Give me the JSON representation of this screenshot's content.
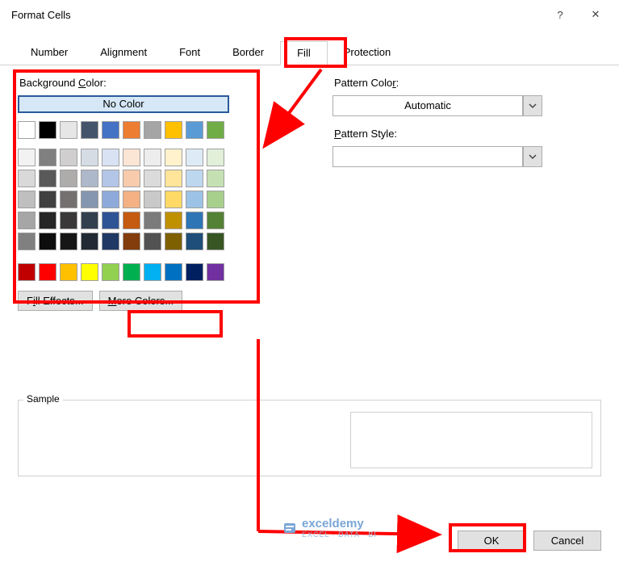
{
  "dialog": {
    "title": "Format Cells",
    "help": "?",
    "close": "✕"
  },
  "tabs": {
    "items": [
      "Number",
      "Alignment",
      "Font",
      "Border",
      "Fill",
      "Protection"
    ],
    "active": "Fill"
  },
  "fill": {
    "bg_label_pre": "Background ",
    "bg_label_u": "C",
    "bg_label_post": "olor:",
    "no_color": "No Color",
    "theme_row1": [
      "#ffffff",
      "#000000",
      "#e7e6e6",
      "#44546a",
      "#4472c4",
      "#ed7d31",
      "#a5a5a5",
      "#ffc000",
      "#5b9bd5",
      "#70ad47"
    ],
    "theme_shades": [
      [
        "#f2f2f2",
        "#808080",
        "#d0cece",
        "#d6dce4",
        "#d9e2f3",
        "#fbe5d5",
        "#ededed",
        "#fff2cc",
        "#deebf6",
        "#e2efd9"
      ],
      [
        "#d9d9d9",
        "#595959",
        "#aeabab",
        "#adb9ca",
        "#b4c6e7",
        "#f7cbac",
        "#dbdbdb",
        "#fee599",
        "#bdd7ee",
        "#c5e0b3"
      ],
      [
        "#bfbfbf",
        "#404040",
        "#757070",
        "#8496b0",
        "#8eaadb",
        "#f4b183",
        "#c9c9c9",
        "#ffd965",
        "#9cc3e5",
        "#a8d08d"
      ],
      [
        "#a6a6a6",
        "#262626",
        "#3a3838",
        "#323f4f",
        "#2f5496",
        "#c55a11",
        "#7b7b7b",
        "#bf9000",
        "#2e75b5",
        "#538135"
      ],
      [
        "#808080",
        "#0d0d0d",
        "#171616",
        "#222a35",
        "#1f3864",
        "#833c0b",
        "#525252",
        "#7f6000",
        "#1e4e79",
        "#375623"
      ]
    ],
    "standard": [
      "#c00000",
      "#ff0000",
      "#ffc000",
      "#ffff00",
      "#92d050",
      "#00b050",
      "#00b0f0",
      "#0070c0",
      "#002060",
      "#7030a0"
    ],
    "fill_effects_u": "i",
    "fill_effects_pre": "F",
    "fill_effects_post": "ll Effects...",
    "more_colors_u": "M",
    "more_colors_post": "ore Colors..."
  },
  "pattern": {
    "color_label_pre": "Pattern Colo",
    "color_label_u": "r",
    "color_label_post": ":",
    "color_value": "Automatic",
    "style_label_u": "P",
    "style_label_post": "attern Style:",
    "style_value": ""
  },
  "sample": {
    "label": "Sample"
  },
  "footer": {
    "ok": "OK",
    "cancel": "Cancel"
  },
  "watermark": {
    "brand": "exceldemy",
    "sub": "EXCEL · DATA · BI"
  }
}
